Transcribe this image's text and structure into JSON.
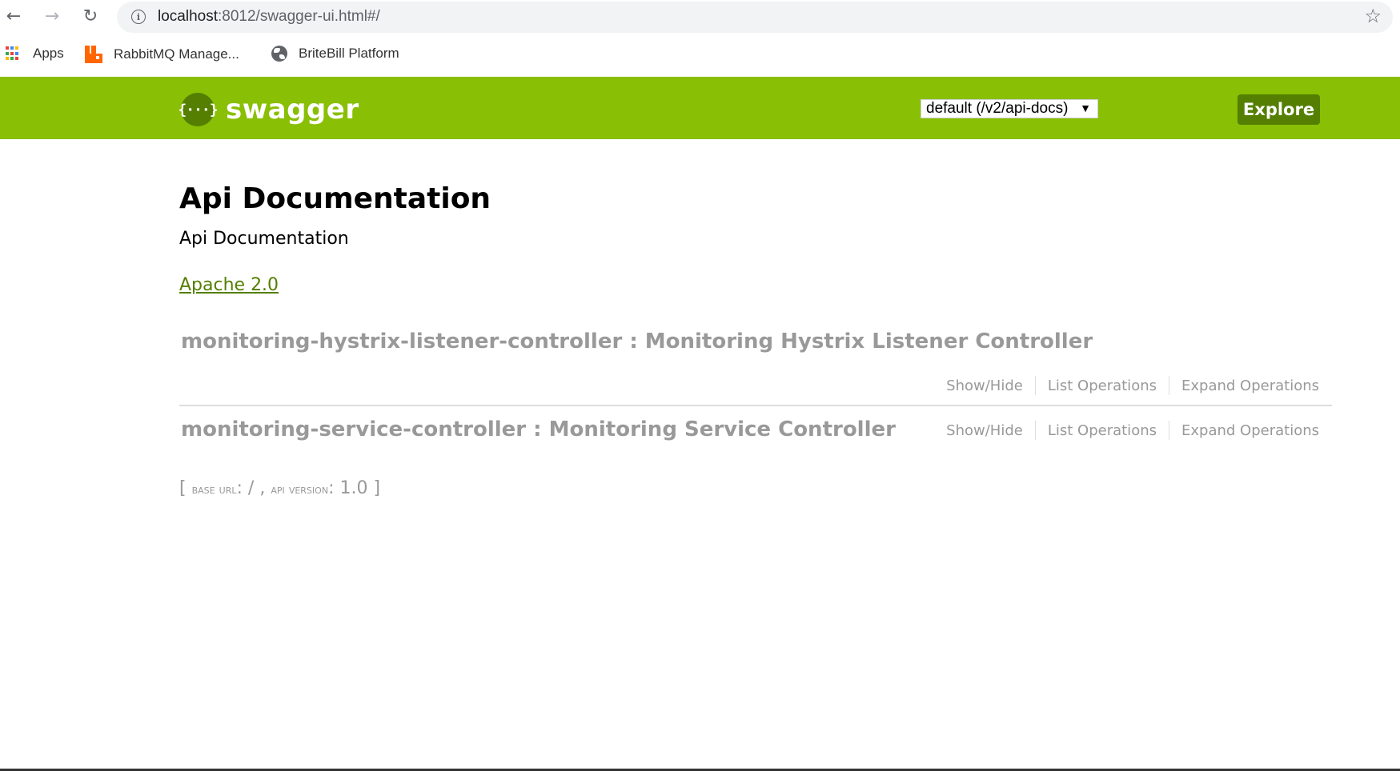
{
  "browser": {
    "nav": {
      "back": "←",
      "forward": "→",
      "reload": "↻"
    },
    "url_host": "localhost",
    "url_rest": ":8012/swagger-ui.html#/",
    "bookmarks": [
      {
        "label": "Apps",
        "icon": "apps-grid-icon"
      },
      {
        "label": "RabbitMQ Manage...",
        "icon": "rabbitmq-icon"
      },
      {
        "label": "BriteBill Platform",
        "icon": "globe-icon"
      }
    ]
  },
  "header": {
    "logo_symbol": "{···}",
    "logo_text": "swagger",
    "spec_select_value": "default (/v2/api-docs)",
    "explore_label": "Explore",
    "brand_color": "#89bf04",
    "dark_color": "#547f00"
  },
  "info": {
    "title": "Api Documentation",
    "description": "Api Documentation",
    "license": "Apache 2.0"
  },
  "resources": [
    {
      "name": "monitoring-hystrix-listener-controller",
      "description": "Monitoring Hystrix Listener Controller",
      "heading": "monitoring-hystrix-listener-controller : Monitoring Hystrix Listener Controller",
      "show_hide": "Show/Hide",
      "list_operations": "List Operations",
      "expand_operations": "Expand Operations"
    },
    {
      "name": "monitoring-service-controller",
      "description": "Monitoring Service Controller",
      "heading": "monitoring-service-controller : Monitoring Service Controller",
      "show_hide": "Show/Hide",
      "list_operations": "List Operations",
      "expand_operations": "Expand Operations"
    }
  ],
  "footer": {
    "open": "[",
    "base_url_label": "base url",
    "base_url_value": ": / ,",
    "api_version_label": "api version",
    "api_version_value": ": 1.0 ]"
  }
}
